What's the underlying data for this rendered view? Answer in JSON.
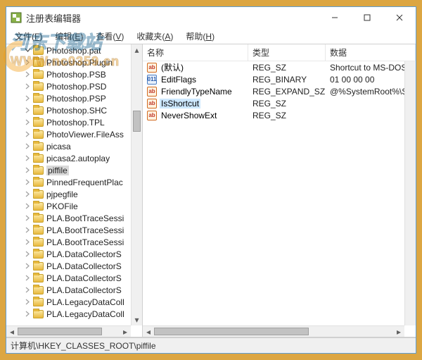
{
  "title": "注册表编辑器",
  "menu": [
    {
      "label": "文件",
      "hotkey": "F"
    },
    {
      "label": "编辑",
      "hotkey": "E"
    },
    {
      "label": "查看",
      "hotkey": "V"
    },
    {
      "label": "收藏夹",
      "hotkey": "A"
    },
    {
      "label": "帮助",
      "hotkey": "H"
    }
  ],
  "tree": {
    "items": [
      {
        "label": "Photoshop.pat",
        "open": true
      },
      {
        "label": "Photoshop.Plugin",
        "open": false
      },
      {
        "label": "Photoshop.PSB",
        "open": false
      },
      {
        "label": "Photoshop.PSD",
        "open": false
      },
      {
        "label": "Photoshop.PSP",
        "open": false
      },
      {
        "label": "Photoshop.SHC",
        "open": false
      },
      {
        "label": "Photoshop.TPL",
        "open": false
      },
      {
        "label": "PhotoViewer.FileAss",
        "open": false
      },
      {
        "label": "picasa",
        "open": false
      },
      {
        "label": "picasa2.autoplay",
        "open": false
      },
      {
        "label": "piffile",
        "open": false,
        "selected": true
      },
      {
        "label": "PinnedFrequentPlac",
        "open": false
      },
      {
        "label": "pjpegfile",
        "open": false
      },
      {
        "label": "PKOFile",
        "open": false
      },
      {
        "label": "PLA.BootTraceSessi",
        "open": false
      },
      {
        "label": "PLA.BootTraceSessi",
        "open": false
      },
      {
        "label": "PLA.BootTraceSessi",
        "open": false
      },
      {
        "label": "PLA.DataCollectorS",
        "open": false
      },
      {
        "label": "PLA.DataCollectorS",
        "open": false
      },
      {
        "label": "PLA.DataCollectorS",
        "open": false
      },
      {
        "label": "PLA.DataCollectorS",
        "open": false
      },
      {
        "label": "PLA.LegacyDataColl",
        "open": false
      },
      {
        "label": "PLA.LegacyDataColl",
        "open": false
      }
    ]
  },
  "list": {
    "headers": {
      "name": "名称",
      "type": "类型",
      "data": "数据"
    },
    "rows": [
      {
        "icon": "str",
        "name": "(默认)",
        "type": "REG_SZ",
        "data": "Shortcut to MS-DOS P"
      },
      {
        "icon": "bin",
        "name": "EditFlags",
        "type": "REG_BINARY",
        "data": "01 00 00 00"
      },
      {
        "icon": "str",
        "name": "FriendlyTypeName",
        "type": "REG_EXPAND_SZ",
        "data": "@%SystemRoot%\\Sys"
      },
      {
        "icon": "str",
        "name": "IsShortcut",
        "type": "REG_SZ",
        "data": "",
        "selected": true
      },
      {
        "icon": "str",
        "name": "NeverShowExt",
        "type": "REG_SZ",
        "data": ""
      }
    ]
  },
  "statusbar": "计算机\\HKEY_CLASSES_ROOT\\piffile",
  "watermark": {
    "line1": "河东下载站",
    "line2": "WWW.nc0359.cn"
  }
}
